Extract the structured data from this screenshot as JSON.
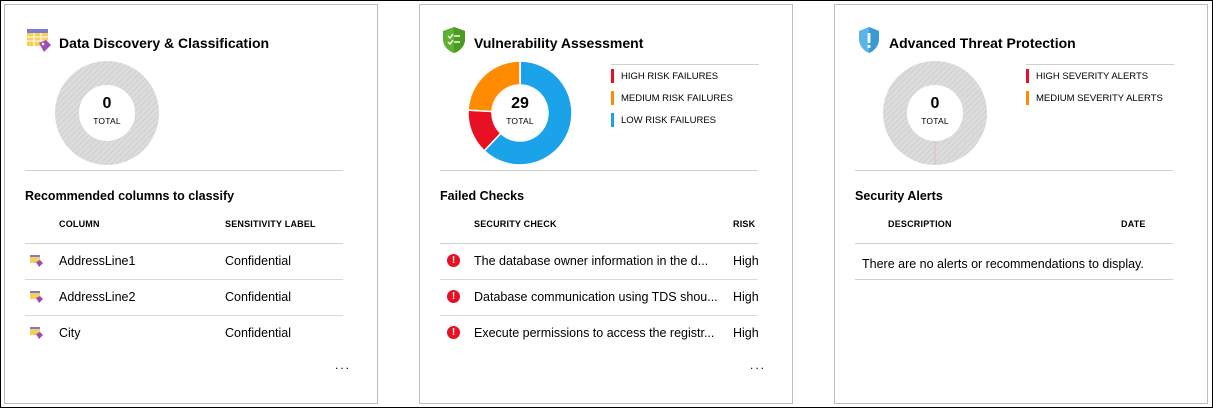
{
  "cards": [
    {
      "title": "Data Discovery & Classification",
      "icon": "table-tag-icon",
      "donut": {
        "value": "0",
        "label": "TOTAL"
      },
      "section_title": "Recommended columns to classify",
      "columns": [
        "COLUMN",
        "SENSITIVITY LABEL"
      ],
      "rows": [
        {
          "column": "AddressLine1",
          "label": "Confidential"
        },
        {
          "column": "AddressLine2",
          "label": "Confidential"
        },
        {
          "column": "City",
          "label": "Confidential"
        }
      ],
      "more": "..."
    },
    {
      "title": "Vulnerability Assessment",
      "icon": "shield-check-icon",
      "donut": {
        "value": "29",
        "label": "TOTAL",
        "segments": [
          {
            "name": "HIGH RISK FAILURES",
            "value": 4,
            "color": "#e81123"
          },
          {
            "name": "MEDIUM RISK FAILURES",
            "value": 7,
            "color": "#ff8c00"
          },
          {
            "name": "LOW RISK FAILURES",
            "value": 18,
            "color": "#1aa3e8"
          }
        ]
      },
      "legend": [
        {
          "label": "HIGH RISK FAILURES",
          "color": "#e81123"
        },
        {
          "label": "MEDIUM RISK FAILURES",
          "color": "#ff8c00"
        },
        {
          "label": "LOW RISK FAILURES",
          "color": "#1aa3e8"
        }
      ],
      "section_title": "Failed Checks",
      "columns": [
        "SECURITY CHECK",
        "RISK"
      ],
      "rows": [
        {
          "check": "The database owner information in the d...",
          "risk": "High"
        },
        {
          "check": "Database communication using TDS shou...",
          "risk": "High"
        },
        {
          "check": "Execute permissions to access the registr...",
          "risk": "High"
        }
      ],
      "more": "..."
    },
    {
      "title": "Advanced Threat Protection",
      "icon": "shield-alert-icon",
      "donut": {
        "value": "0",
        "label": "TOTAL"
      },
      "legend": [
        {
          "label": "HIGH SEVERITY ALERTS",
          "color": "#e81123"
        },
        {
          "label": "MEDIUM SEVERITY ALERTS",
          "color": "#ff8c00"
        }
      ],
      "section_title": "Security Alerts",
      "columns": [
        "DESCRIPTION",
        "DATE"
      ],
      "empty_message": "There are no alerts or recommendations to display."
    }
  ]
}
